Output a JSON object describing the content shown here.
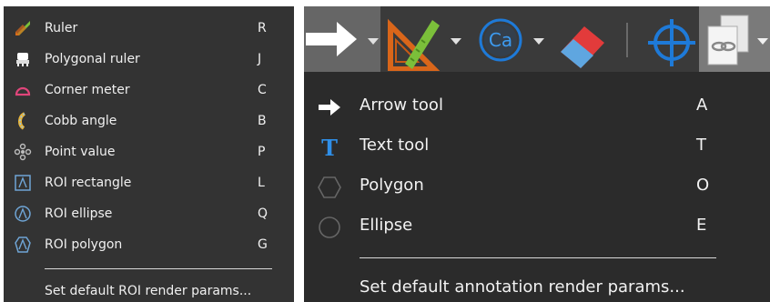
{
  "left_menu": {
    "items": [
      {
        "label": "Ruler",
        "key": "R",
        "icon": "ruler-icon"
      },
      {
        "label": "Polygonal ruler",
        "key": "J",
        "icon": "polygonal-ruler-icon"
      },
      {
        "label": "Corner meter",
        "key": "C",
        "icon": "corner-meter-icon"
      },
      {
        "label": "Cobb angle",
        "key": "B",
        "icon": "cobb-angle-icon"
      },
      {
        "label": "Point value",
        "key": "P",
        "icon": "point-value-icon"
      },
      {
        "label": "ROI rectangle",
        "key": "L",
        "icon": "roi-rectangle-icon"
      },
      {
        "label": "ROI ellipse",
        "key": "Q",
        "icon": "roi-ellipse-icon"
      },
      {
        "label": "ROI polygon",
        "key": "G",
        "icon": "roi-polygon-icon"
      }
    ],
    "footer": "Set default ROI render params..."
  },
  "toolbar": {
    "buttons": [
      "arrow-tool-icon",
      "measure-set-square-icon",
      "ca-calcium-icon",
      "eraser-icon",
      "crosshair-icon",
      "linked-documents-icon"
    ],
    "ca_label": "Ca"
  },
  "right_menu": {
    "items": [
      {
        "label": "Arrow tool",
        "key": "A",
        "icon": "arrow-icon"
      },
      {
        "label": "Text tool",
        "key": "T",
        "icon": "text-t-icon"
      },
      {
        "label": "Polygon",
        "key": "O",
        "icon": "polygon-icon"
      },
      {
        "label": "Ellipse",
        "key": "E",
        "icon": "ellipse-icon"
      }
    ],
    "footer": "Set default annotation render params..."
  },
  "colors": {
    "menu_bg": "#333333",
    "panel_bg": "#2b2b2b",
    "toolbar_bg": "#3a3a3a",
    "text": "#f0f0f0",
    "accent_blue": "#1e7ad8"
  }
}
